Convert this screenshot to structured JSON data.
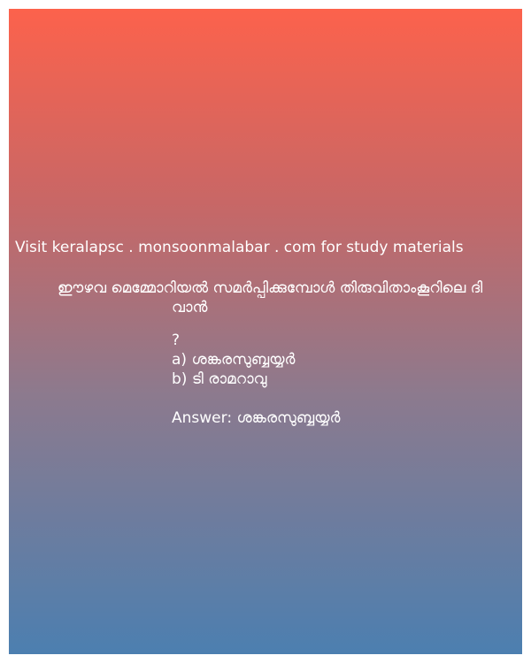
{
  "site_line": "Visit keralapsc . monsoonmalabar . com for study materials",
  "question": {
    "line1": "ഈഴവ മെമ്മോറിയൽ സമർപ്പിക്കുമ്പോൾ തിരുവിതാംകൂറിലെ ദി",
    "line2": "വാൻ",
    "mark": "?"
  },
  "options": {
    "a": "a) ശങ്കരസുബ്ബയ്യർ",
    "b": "b) ടി  രാമറാവു"
  },
  "answer": "Answer: ശങ്കരസുബ്ബയ്യർ",
  "colors": {
    "gradient_top": "#fc624c",
    "gradient_bottom": "#4c7fb0",
    "text": "#ffffff"
  }
}
